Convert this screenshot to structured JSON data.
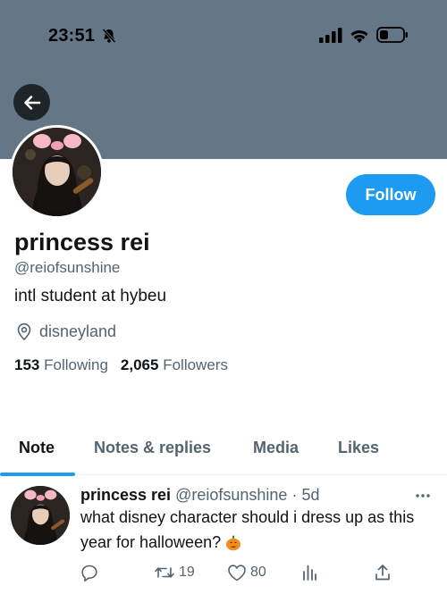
{
  "status_bar": {
    "time": "23:51",
    "icons": [
      "bell-slash-icon",
      "signal-icon",
      "wifi-icon",
      "battery-icon"
    ]
  },
  "header": {
    "back_icon": "arrow-left-icon",
    "banner_color": "#657786"
  },
  "profile": {
    "display_name": "princess rei",
    "handle": "@reiofsunshine",
    "bio": "intl student at hybeu",
    "location": "disneyland",
    "following_count": "153",
    "following_label": "Following",
    "followers_count": "2,065",
    "followers_label": "Followers",
    "follow_button_label": "Follow",
    "accent_color": "#1d9bf0"
  },
  "tabs": [
    {
      "label": "Note",
      "active": true
    },
    {
      "label": "Notes & replies",
      "active": false
    },
    {
      "label": "Media",
      "active": false
    },
    {
      "label": "Likes",
      "active": false
    }
  ],
  "tweet": {
    "author_name": "princess rei",
    "author_handle": "@reiofsunshine",
    "separator": "·",
    "time_ago": "5d",
    "text": "what disney character should i dress up as this year for halloween?",
    "emoji_icon": "jack-o-lantern-icon",
    "actions": {
      "reply_icon": "reply-icon",
      "retweet_icon": "retweet-icon",
      "retweet_count": "19",
      "like_icon": "heart-icon",
      "like_count": "80",
      "analytics_icon": "analytics-icon",
      "share_icon": "share-icon"
    }
  }
}
